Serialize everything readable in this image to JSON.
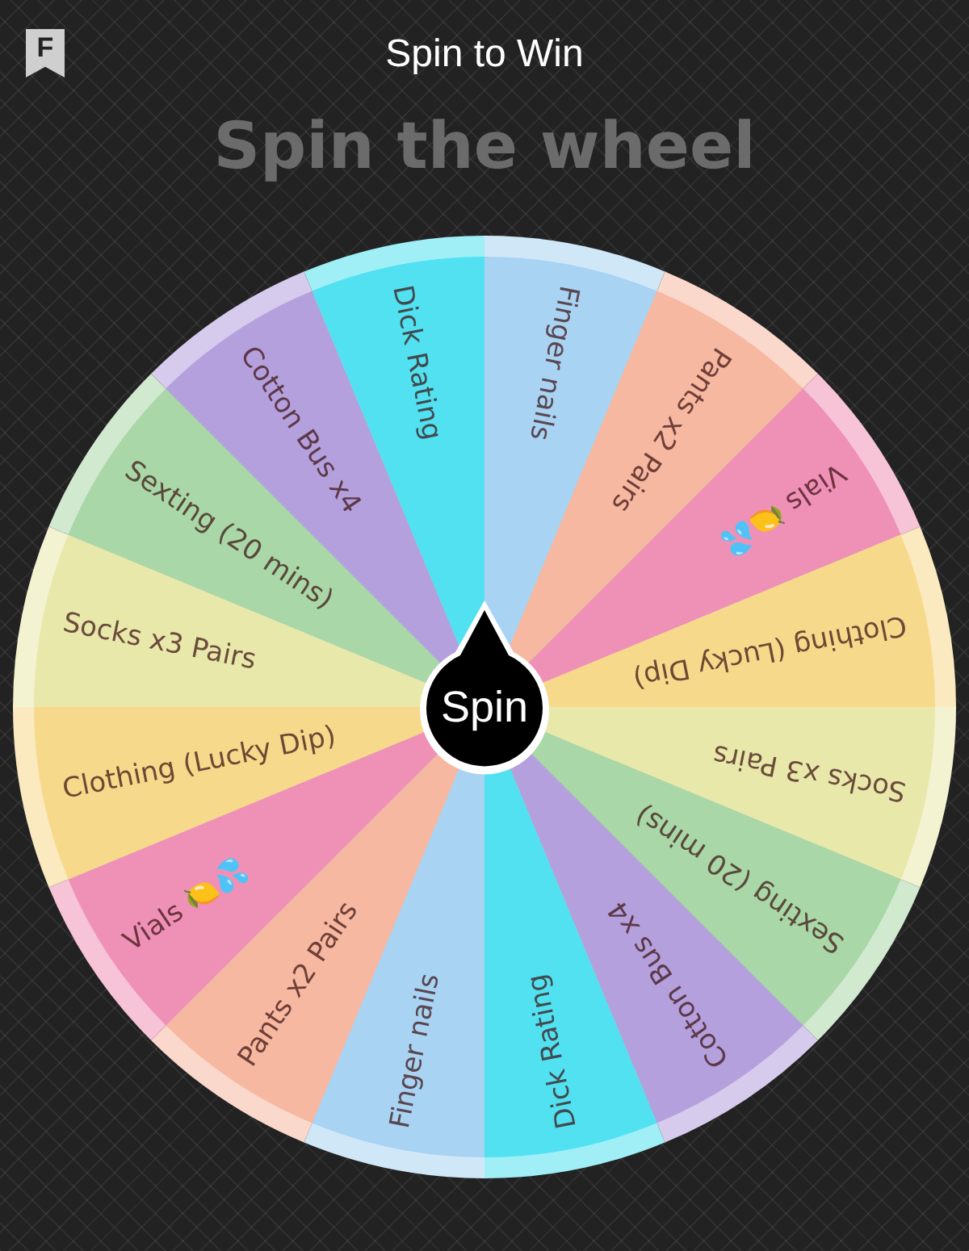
{
  "header": {
    "badge": "F",
    "title": "Spin to Win"
  },
  "heading": "Spin the wheel",
  "wheel": {
    "button": "Spin",
    "segments": [
      {
        "label": "Finger nails",
        "color": "#a9d3f3"
      },
      {
        "label": "Pants x2 Pairs",
        "color": "#f6b8a0"
      },
      {
        "label": "Vials 🍋💦",
        "color": "#ef91b7"
      },
      {
        "label": "Clothing (Lucky Dip)",
        "color": "#f7d98c"
      },
      {
        "label": "Socks x3 Pairs",
        "color": "#e9e8ab"
      },
      {
        "label": "Sexting (20 mins)",
        "color": "#a9d7a8"
      },
      {
        "label": "Cotton Bus x4",
        "color": "#b4a0dc"
      },
      {
        "label": "Dick Rating",
        "color": "#52e1f1"
      },
      {
        "label": "Finger nails",
        "color": "#a9d3f3"
      },
      {
        "label": "Pants x2 Pairs",
        "color": "#f6b8a0"
      },
      {
        "label": "Vials 🍋💦",
        "color": "#ef91b7"
      },
      {
        "label": "Clothing (Lucky Dip)",
        "color": "#f7d98c"
      },
      {
        "label": "Socks x3 Pairs",
        "color": "#e9e8ab"
      },
      {
        "label": "Sexting (20 mins)",
        "color": "#a9d7a8"
      },
      {
        "label": "Cotton Bus x4",
        "color": "#b4a0dc"
      },
      {
        "label": "Dick Rating",
        "color": "#52e1f1"
      }
    ]
  }
}
